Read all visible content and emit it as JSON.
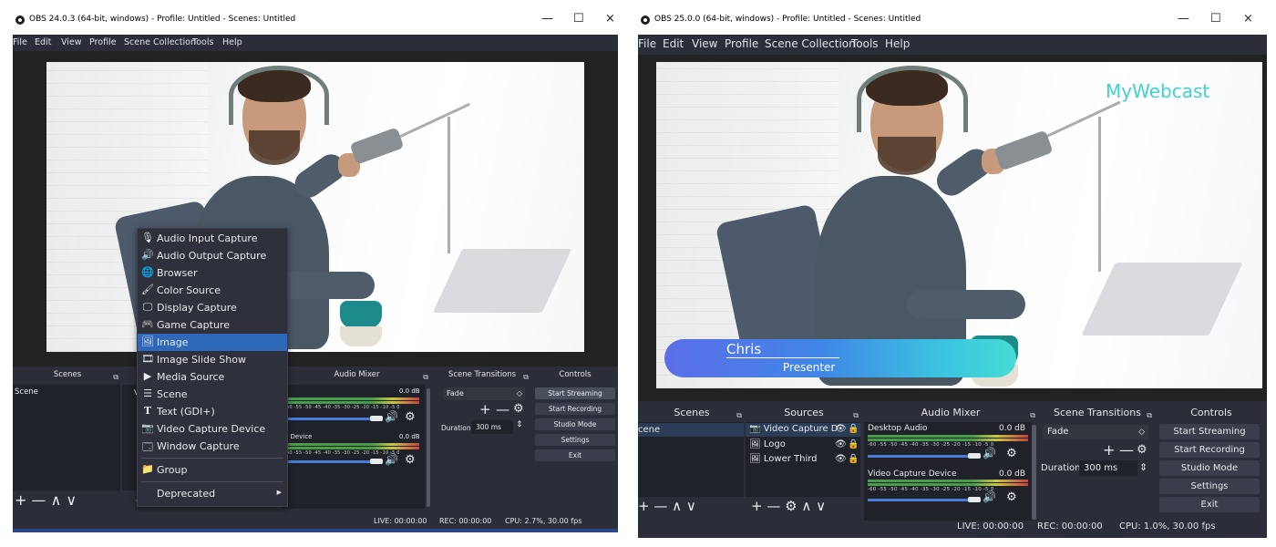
{
  "left": {
    "title": "OBS 24.0.3 (64-bit, windows) - Profile: Untitled - Scenes: Untitled",
    "menu": [
      "File",
      "Edit",
      "View",
      "Profile",
      "Scene Collection",
      "Tools",
      "Help"
    ],
    "docks": {
      "scenes": "Scenes",
      "sources_prefix": "Vi",
      "mixer": "Audio Mixer",
      "transitions": "Scene Transitions",
      "controls": "Controls"
    },
    "scene_item": "Scene",
    "mixer": {
      "ch1": {
        "name_fragment": "o",
        "db": "0.0 dB"
      },
      "ch2": {
        "name_fragment": "e Device",
        "db": "0.0 dB"
      },
      "ticks": "-60 -55 -50 -45 -40 -35 -30 -25 -20 -15 -10 -5 0"
    },
    "transitions": {
      "selected": "Fade",
      "duration_label": "Duration",
      "duration_value": "300 ms"
    },
    "controls": [
      "Start Streaming",
      "Start Recording",
      "Studio Mode",
      "Settings",
      "Exit"
    ],
    "status": {
      "live": "LIVE: 00:00:00",
      "rec": "REC: 00:00:00",
      "cpu": "CPU: 2.7%, 30.00 fps"
    },
    "context_menu": [
      {
        "icon": "microphone-icon",
        "glyph": "🎙",
        "label": "Audio Input Capture"
      },
      {
        "icon": "speaker-icon",
        "glyph": "🔊",
        "label": "Audio Output Capture"
      },
      {
        "icon": "globe-icon",
        "glyph": "🌐",
        "label": "Browser"
      },
      {
        "icon": "paint-brush-icon",
        "glyph": "🖌",
        "label": "Color Source"
      },
      {
        "icon": "monitor-icon",
        "glyph": "🖵",
        "label": "Display Capture"
      },
      {
        "icon": "gamepad-icon",
        "glyph": "🎮",
        "label": "Game Capture"
      },
      {
        "icon": "image-icon",
        "glyph": "🖼",
        "label": "Image"
      },
      {
        "icon": "slideshow-icon",
        "glyph": "🎞",
        "label": "Image Slide Show"
      },
      {
        "icon": "play-icon",
        "glyph": "▶",
        "label": "Media Source"
      },
      {
        "icon": "list-icon",
        "glyph": "☰",
        "label": "Scene"
      },
      {
        "icon": "text-icon",
        "glyph": "T",
        "label": "Text (GDI+)"
      },
      {
        "icon": "camera-icon",
        "glyph": "📷",
        "label": "Video Capture Device"
      },
      {
        "icon": "window-icon",
        "glyph": "🗔",
        "label": "Window Capture"
      },
      {
        "icon": "folder-icon",
        "glyph": "📁",
        "label": "Group"
      },
      {
        "icon": "",
        "glyph": "",
        "label": "Deprecated"
      }
    ]
  },
  "right": {
    "title": "OBS 25.0.0 (64-bit, windows) - Profile: Untitled - Scenes: Untitled",
    "menu": [
      "File",
      "Edit",
      "View",
      "Profile",
      "Scene Collection",
      "Tools",
      "Help"
    ],
    "overlay": {
      "brand": "MyWebcast",
      "name": "Chris",
      "role": "Presenter"
    },
    "docks": {
      "scenes": "Scenes",
      "sources": "Sources",
      "mixer": "Audio Mixer",
      "transitions": "Scene Transitions",
      "controls": "Controls"
    },
    "scene_item": "cene",
    "sources": [
      {
        "icon": "camera-icon",
        "label": "Video Capture D"
      },
      {
        "icon": "image-icon",
        "label": "Logo"
      },
      {
        "icon": "image-icon",
        "label": "Lower Third"
      }
    ],
    "mixer": {
      "ch1": {
        "name": "Desktop Audio",
        "db": "0.0 dB"
      },
      "ch2": {
        "name": "Video Capture Device",
        "db": "0.0 dB"
      },
      "ticks": "-60 -55 -50 -45 -40 -35 -30 -25 -20 -15 -10 -5 0"
    },
    "transitions": {
      "selected": "Fade",
      "duration_label": "Duration",
      "duration_value": "300 ms"
    },
    "controls": [
      "Start Streaming",
      "Start Recording",
      "Studio Mode",
      "Settings",
      "Exit"
    ],
    "status": {
      "live": "LIVE: 00:00:00",
      "rec": "REC: 00:00:00",
      "cpu": "CPU: 1.0%, 30.00 fps"
    }
  }
}
